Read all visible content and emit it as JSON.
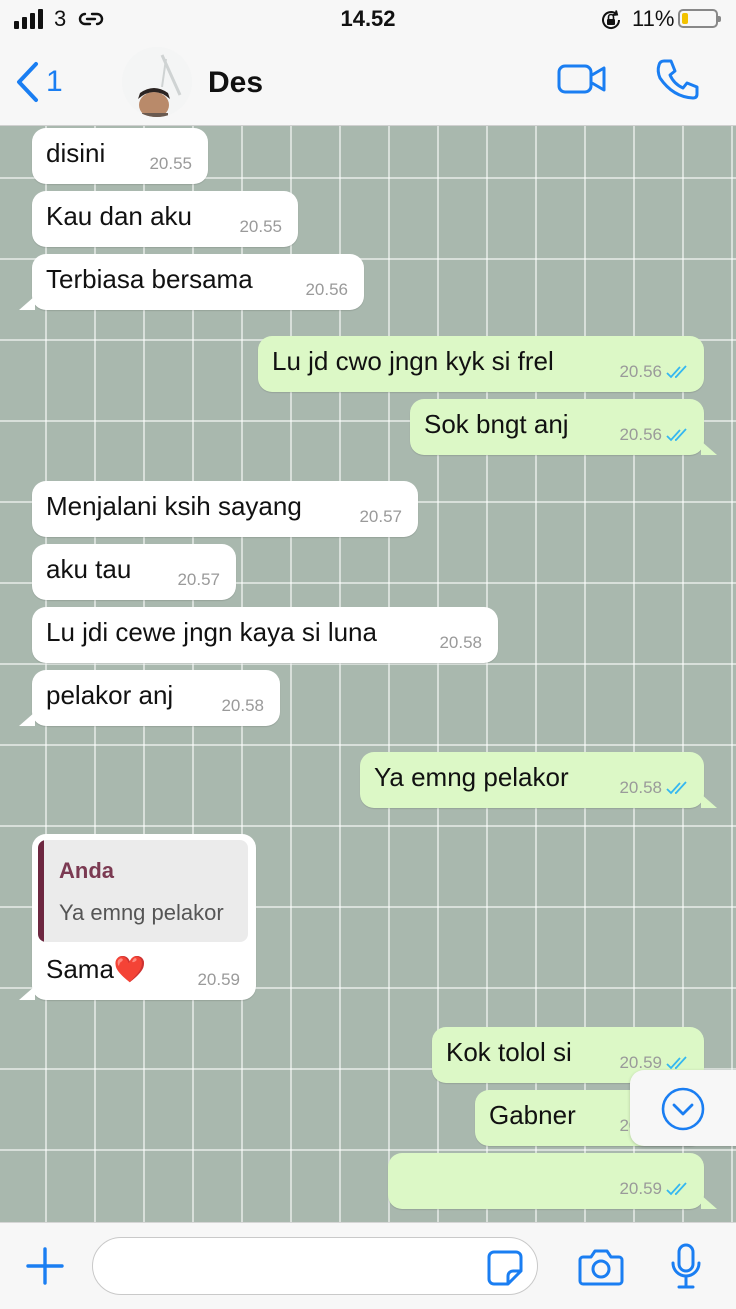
{
  "status_bar": {
    "carrier": "3",
    "time": "14.52",
    "battery_percent": "11%",
    "battery_level": 0.11,
    "signal_bars": 4
  },
  "header": {
    "back_count": "1",
    "contact_name": "Des",
    "accent_color": "#1a7ef2"
  },
  "messages": [
    {
      "direction": "in",
      "text": "disini",
      "time": "20.55"
    },
    {
      "direction": "in",
      "text": "Kau dan aku",
      "time": "20.55"
    },
    {
      "direction": "in",
      "text": "Terbiasa bersama",
      "time": "20.56"
    },
    {
      "direction": "out",
      "text": "Lu jd cwo jngn kyk si frel",
      "time": "20.56",
      "status": "read"
    },
    {
      "direction": "out",
      "text": "Sok bngt anj",
      "time": "20.56",
      "status": "read"
    },
    {
      "direction": "in",
      "text": "Menjalani ksih sayang",
      "time": "20.57"
    },
    {
      "direction": "in",
      "text": "aku tau",
      "time": "20.57"
    },
    {
      "direction": "in",
      "text": "Lu jdi cewe jngn kaya si luna",
      "time": "20.58"
    },
    {
      "direction": "in",
      "text": "pelakor anj",
      "time": "20.58"
    },
    {
      "direction": "out",
      "text": "Ya emng pelakor",
      "time": "20.58",
      "status": "read"
    },
    {
      "direction": "in",
      "text": "Sama❤️",
      "time": "20.59",
      "quote_author": "Anda",
      "quote_text": "Ya emng pelakor"
    },
    {
      "direction": "out",
      "text": "Kok tolol si",
      "time": "20.59",
      "status": "read"
    },
    {
      "direction": "out",
      "text": "Gabner",
      "time": "20.59",
      "status": "read"
    },
    {
      "direction": "out",
      "text": "",
      "time": "20.59",
      "status": "read"
    }
  ],
  "input": {
    "value": "",
    "placeholder": ""
  },
  "colors": {
    "incoming_bubble": "#ffffff",
    "outgoing_bubble": "#dcf8c6",
    "read_tick": "#34b7f1",
    "quote_bar": "#6d2740",
    "chat_background": "#a9b8ae"
  },
  "icons": [
    "signal-icon",
    "link-icon",
    "orientation-lock-icon",
    "battery-icon",
    "back-chevron-icon",
    "video-call-icon",
    "phone-icon",
    "scroll-down-icon",
    "plus-icon",
    "sticker-icon",
    "camera-icon",
    "microphone-icon"
  ]
}
